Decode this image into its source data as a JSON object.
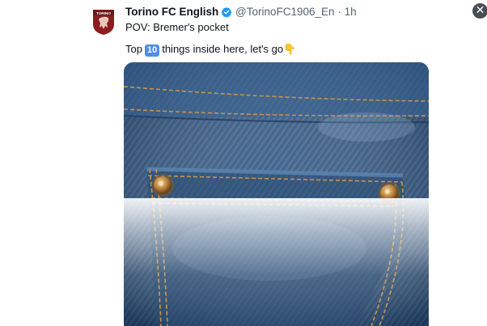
{
  "tweet": {
    "display_name": "Torino FC English",
    "handle": "@TorinoFC1906_En",
    "separator": "·",
    "time": "1h",
    "line1": "POV: Bremer's pocket",
    "line2_before": "Top",
    "keycap_number": "10",
    "line2_after": "things inside here, let's go",
    "pointing_emoji": "👇",
    "avatar_text": "TORINO",
    "close_glyph": "✕"
  },
  "colors": {
    "brand": "#8a1e1e",
    "verified": "#1d9bf0",
    "denim": "#30557f",
    "stitch": "#c9934a"
  },
  "icons": {
    "verified": "verified-badge-icon",
    "close": "close-icon",
    "pointing": "backhand-index-pointing-down-icon"
  }
}
